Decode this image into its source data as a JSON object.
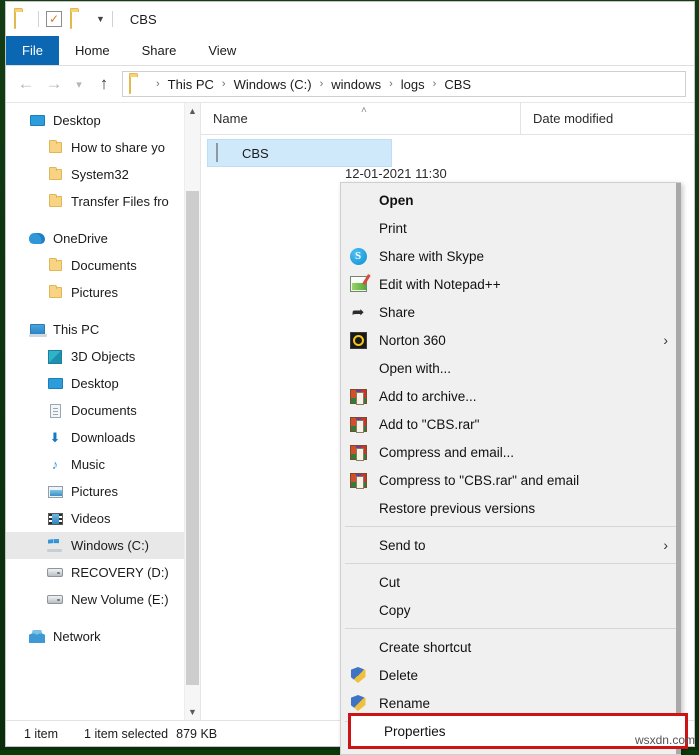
{
  "window": {
    "title": "CBS",
    "quick_access": [
      "folder-icon",
      "checkbox-icon",
      "folder-icon",
      "dropdown-caret-icon"
    ]
  },
  "ribbon": {
    "tabs": [
      {
        "label": "File",
        "active": true
      },
      {
        "label": "Home",
        "active": false
      },
      {
        "label": "Share",
        "active": false
      },
      {
        "label": "View",
        "active": false
      }
    ]
  },
  "navigation": {
    "back_icon": "back-arrow-icon",
    "forward_icon": "forward-arrow-icon",
    "recent_icon": "chevron-down-icon",
    "up_icon": "up-arrow-icon",
    "breadcrumb": [
      "This PC",
      "Windows (C:)",
      "windows",
      "logs",
      "CBS"
    ],
    "separator": "›"
  },
  "sidebar": {
    "items": [
      {
        "label": "Desktop",
        "icon": "desktop-icon",
        "indent": 0,
        "selected": false
      },
      {
        "label": "How to share yo",
        "icon": "folder-icon",
        "indent": 1,
        "selected": false
      },
      {
        "label": "System32",
        "icon": "folder-icon",
        "indent": 1,
        "selected": false
      },
      {
        "label": "Transfer Files fro",
        "icon": "folder-icon",
        "indent": 1,
        "selected": false
      },
      {
        "label": "OneDrive",
        "icon": "onedrive-icon",
        "indent": 0,
        "selected": false,
        "gap_before": true
      },
      {
        "label": "Documents",
        "icon": "folder-icon",
        "indent": 1,
        "selected": false
      },
      {
        "label": "Pictures",
        "icon": "folder-icon",
        "indent": 1,
        "selected": false
      },
      {
        "label": "This PC",
        "icon": "this-pc-icon",
        "indent": 0,
        "selected": false,
        "gap_before": true
      },
      {
        "label": "3D Objects",
        "icon": "3d-objects-icon",
        "indent": 1,
        "selected": false
      },
      {
        "label": "Desktop",
        "icon": "desktop-icon",
        "indent": 1,
        "selected": false
      },
      {
        "label": "Documents",
        "icon": "documents-icon",
        "indent": 1,
        "selected": false
      },
      {
        "label": "Downloads",
        "icon": "downloads-icon",
        "indent": 1,
        "selected": false
      },
      {
        "label": "Music",
        "icon": "music-icon",
        "indent": 1,
        "selected": false
      },
      {
        "label": "Pictures",
        "icon": "pictures-icon",
        "indent": 1,
        "selected": false
      },
      {
        "label": "Videos",
        "icon": "videos-icon",
        "indent": 1,
        "selected": false
      },
      {
        "label": "Windows (C:)",
        "icon": "windows-drive-icon",
        "indent": 1,
        "selected": true
      },
      {
        "label": "RECOVERY (D:)",
        "icon": "drive-icon",
        "indent": 1,
        "selected": false
      },
      {
        "label": "New Volume (E:)",
        "icon": "drive-icon",
        "indent": 1,
        "selected": false
      },
      {
        "label": "Network",
        "icon": "network-icon",
        "indent": 0,
        "selected": false,
        "gap_before": true
      }
    ]
  },
  "file_list": {
    "columns": [
      {
        "label": "Name",
        "sorted": true,
        "sort_caret": "˄"
      },
      {
        "label": "Date modified",
        "sorted": false
      }
    ],
    "rows": [
      {
        "name": "CBS",
        "icon": "text-file-icon",
        "date_modified": "12-01-2021 11:30",
        "selected": true
      }
    ]
  },
  "status_bar": {
    "item_count": "1 item",
    "selection": "1 item selected",
    "size": "879 KB"
  },
  "context_menu": {
    "items": [
      {
        "label": "Open",
        "icon": null,
        "bold": true,
        "submenu": false
      },
      {
        "label": "Print",
        "icon": null,
        "bold": false,
        "submenu": false
      },
      {
        "label": "Share with Skype",
        "icon": "skype-icon",
        "bold": false,
        "submenu": false
      },
      {
        "label": "Edit with Notepad++",
        "icon": "notepadpp-icon",
        "bold": false,
        "submenu": false
      },
      {
        "label": "Share",
        "icon": "share-icon",
        "bold": false,
        "submenu": false
      },
      {
        "label": "Norton 360",
        "icon": "norton-icon",
        "bold": false,
        "submenu": true
      },
      {
        "label": "Open with...",
        "icon": null,
        "bold": false,
        "submenu": false
      },
      {
        "label": "Add to archive...",
        "icon": "winrar-icon",
        "bold": false,
        "submenu": false
      },
      {
        "label": "Add to \"CBS.rar\"",
        "icon": "winrar-icon",
        "bold": false,
        "submenu": false
      },
      {
        "label": "Compress and email...",
        "icon": "winrar-icon",
        "bold": false,
        "submenu": false
      },
      {
        "label": "Compress to \"CBS.rar\" and email",
        "icon": "winrar-icon",
        "bold": false,
        "submenu": false
      },
      {
        "label": "Restore previous versions",
        "icon": null,
        "bold": false,
        "submenu": false
      },
      {
        "separator": true
      },
      {
        "label": "Send to",
        "icon": null,
        "bold": false,
        "submenu": true
      },
      {
        "separator": true
      },
      {
        "label": "Cut",
        "icon": null,
        "bold": false,
        "submenu": false
      },
      {
        "label": "Copy",
        "icon": null,
        "bold": false,
        "submenu": false
      },
      {
        "separator": true
      },
      {
        "label": "Create shortcut",
        "icon": null,
        "bold": false,
        "submenu": false
      },
      {
        "label": "Delete",
        "icon": "shield-icon",
        "bold": false,
        "submenu": false
      },
      {
        "label": "Rename",
        "icon": "rename-shield-folder-icon",
        "bold": false,
        "submenu": false
      },
      {
        "separator": true
      },
      {
        "label": "Properties",
        "icon": null,
        "bold": false,
        "submenu": false,
        "highlighted": true
      }
    ],
    "submenu_arrow": "›"
  },
  "annotation": {
    "highlight_label": "Properties",
    "highlight_color": "#cc1414"
  },
  "watermark": {
    "text": "wsxdn.com"
  },
  "colors": {
    "accent": "#0b67b2",
    "selection": "#cfe8fa",
    "menu_bg": "#f0f0f0",
    "highlight": "#cc1414"
  }
}
